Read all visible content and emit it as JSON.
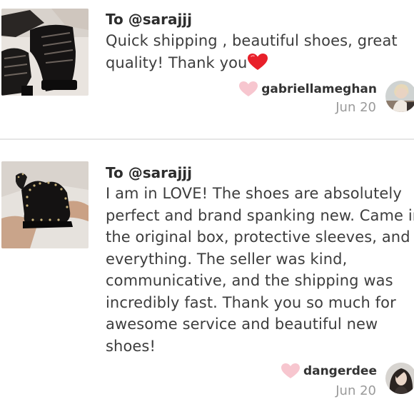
{
  "reviews": [
    {
      "to": "To @sarajjj",
      "body_lines": [
        "Quick shipping , beautiful shoes, great",
        "quality! Thank you"
      ],
      "emoji": "red-heart-emoji",
      "username": "gabriellameghan",
      "date": "Jun 20",
      "photo": "black-lace-up-platform-boots-photo",
      "avatar": "user-avatar"
    },
    {
      "to": "To @sarajjj",
      "body_lines": [
        "I am in LOVE! The shoes are absolutely",
        "perfect and brand spanking new. Came in",
        "the original box, protective sleeves, and",
        "everything. The seller was kind,",
        "communicative, and the shipping was",
        "incredibly fast. Thank you so much for",
        "awesome service and beautiful new",
        "shoes!"
      ],
      "username": "dangerdee",
      "date": "Jun 20",
      "photo": "studded-black-chelsea-boots-photo",
      "avatar": "user-avatar"
    }
  ],
  "colors": {
    "like_heart": "#f7c6cf",
    "emoji_heart": "#e8202a",
    "divider": "#e6e6e6",
    "date": "#9a9a9a"
  }
}
